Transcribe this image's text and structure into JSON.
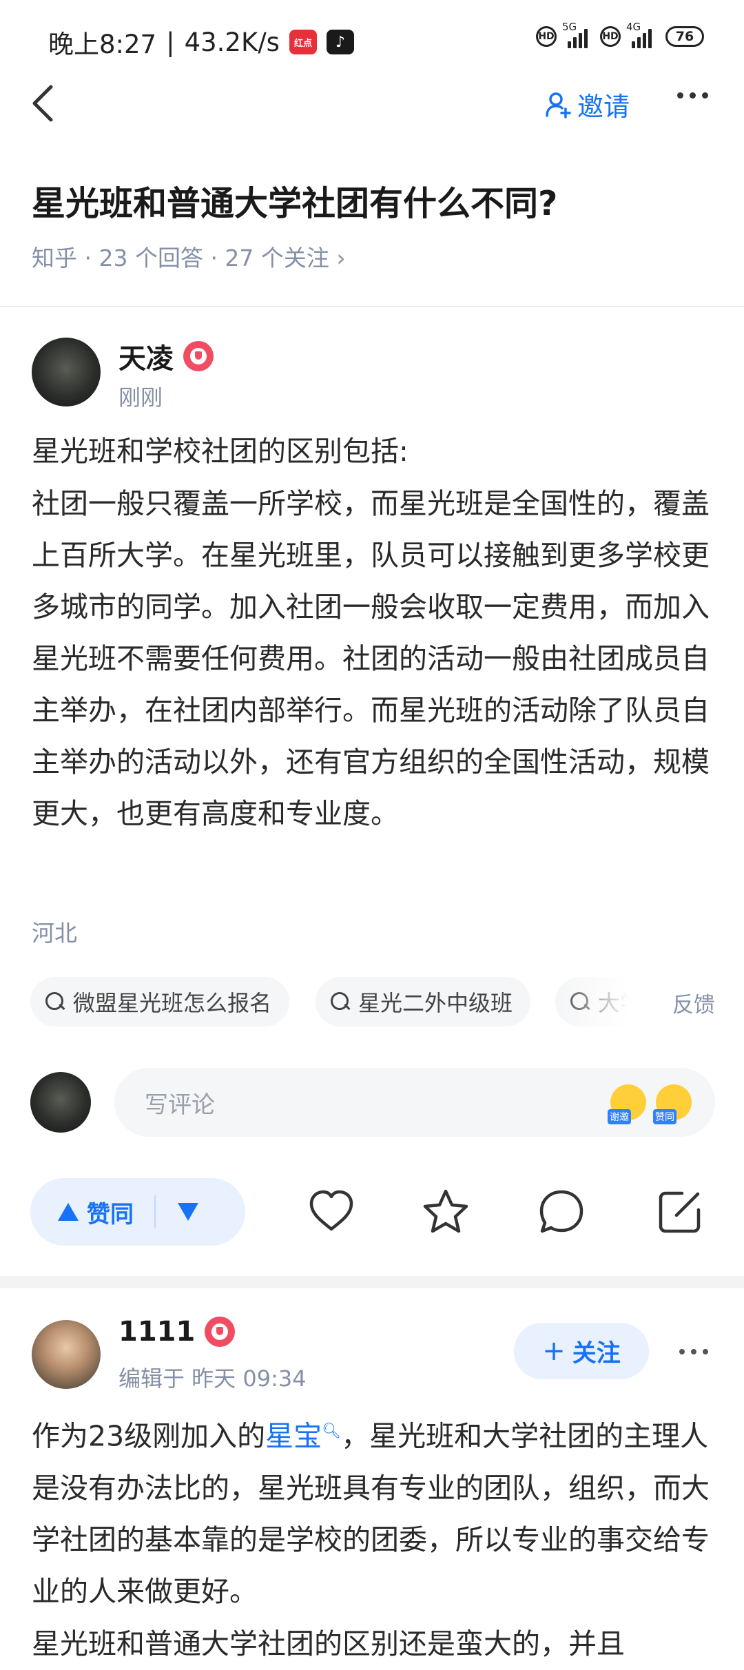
{
  "status_bar": {
    "time": "晚上8:27",
    "separator": "|",
    "net_speed": "43.2K/s",
    "app_badge_1": "红点",
    "sim1_tag": "5G",
    "sim2_tag": "4G",
    "hd1": "HD",
    "hd2": "HD",
    "battery": "76"
  },
  "nav": {
    "invite_label": "邀请"
  },
  "question": {
    "title": "星光班和普通大学社团有什么不同?",
    "meta": "知乎 · 23 个回答 · 27 个关注 ›"
  },
  "answer1": {
    "author": "天凌",
    "time": "刚刚",
    "paragraphs": [
      "星光班和学校社团的区别包括:",
      "社团一般只覆盖一所学校，而星光班是全国性的，覆盖上百所大学。在星光班里，队员可以接触到更多学校更多城市的同学。加入社团一般会收取一定费用，而加入星光班不需要任何费用。社团的活动一般由社团成员自主举办，在社团内部举行。而星光班的活动除了队员自主举办的活动以外，还有官方组织的全国性活动，规模更大，也更有高度和专业度。"
    ],
    "location": "河北",
    "related_searches": [
      "微盟星光班怎么报名",
      "星光二外中级班",
      "大学"
    ],
    "feedback": "反馈",
    "comment_placeholder": "写评论",
    "emoji_1_label": "谢邀",
    "emoji_2_label": "赞同",
    "vote_label": "赞同"
  },
  "answer2": {
    "author": "1111",
    "time": "编辑于 昨天 09:34",
    "follow_label": "关注",
    "follow_plus": "+",
    "p1_before": "作为23级刚加入的",
    "p1_link": "星宝",
    "p1_after": "，星光班和大学社团的主理人是没有办法比的，星光班具有专业的团队，组织，而大学社团的基本靠的是学校的团委，所以专业的事交给专业的人来做更好。",
    "p2": "星光班和普通大学社团的区别还是蛮大的，并且"
  },
  "colors": {
    "accent": "#1772f6",
    "badge": "#f04d63",
    "meta_gray": "#8590a6"
  }
}
